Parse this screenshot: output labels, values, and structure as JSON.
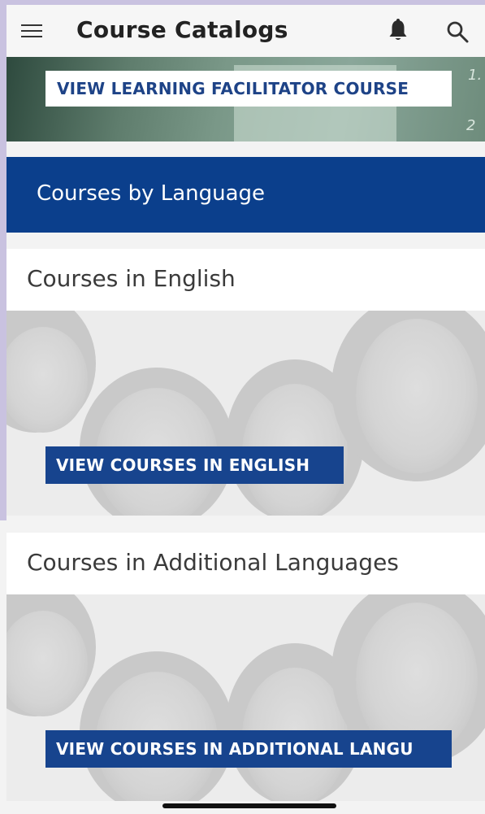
{
  "app": {
    "title": "Course Catalogs",
    "icons": {
      "menu": "hamburger-menu-icon",
      "notifications": "bell-icon",
      "search": "search-icon"
    }
  },
  "banner": {
    "button_label": "VIEW LEARNING FACILITATOR COURSE",
    "numbers": [
      "1.",
      "2"
    ]
  },
  "language_section": {
    "heading": "Courses by Language"
  },
  "sections": [
    {
      "title": "Courses in English",
      "button_label": "VIEW COURSES IN ENGLISH"
    },
    {
      "title": "Courses in Additional Languages",
      "button_label": "VIEW COURSES IN ADDITIONAL LANGU"
    }
  ],
  "colors": {
    "primary_blue": "#0b3f8c",
    "button_blue": "#17448e",
    "button_text_blue": "#1e4387",
    "side_strip": "#c9c2e0"
  }
}
